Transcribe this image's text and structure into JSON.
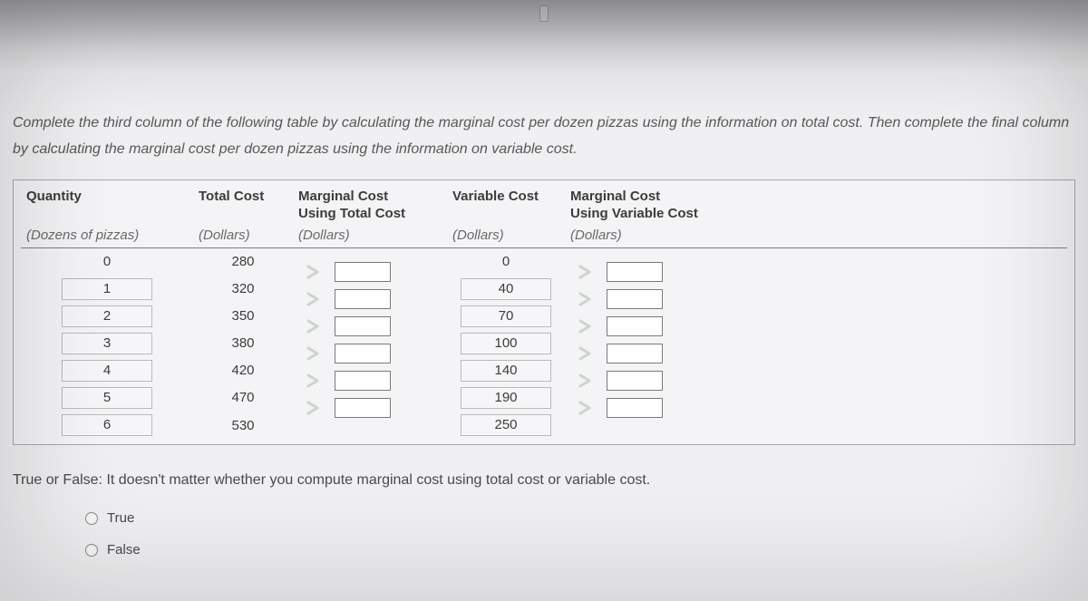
{
  "instructions": "Complete the third column of the following table by calculating the marginal cost per dozen pizzas using the information on total cost. Then complete the final column by calculating the marginal cost per dozen pizzas using the information on variable cost.",
  "headers": {
    "qty": "Quantity",
    "qty_sub": "(Dozens of pizzas)",
    "tc": "Total Cost",
    "tc_sub": "(Dollars)",
    "mc1": "Marginal Cost",
    "mc1b": "Using Total Cost",
    "mc1_sub": "(Dollars)",
    "vc": "Variable Cost",
    "vc_sub": "(Dollars)",
    "mc2": "Marginal Cost",
    "mc2b": "Using Variable Cost",
    "mc2_sub": "(Dollars)"
  },
  "rows": [
    {
      "qty": "0",
      "tc": "280",
      "vc": "0"
    },
    {
      "qty": "1",
      "tc": "320",
      "vc": "40"
    },
    {
      "qty": "2",
      "tc": "350",
      "vc": "70"
    },
    {
      "qty": "3",
      "tc": "380",
      "vc": "100"
    },
    {
      "qty": "4",
      "tc": "420",
      "vc": "140"
    },
    {
      "qty": "5",
      "tc": "470",
      "vc": "190"
    },
    {
      "qty": "6",
      "tc": "530",
      "vc": "250"
    }
  ],
  "question": "True or False: It doesn't matter whether you compute marginal cost using total cost or variable cost.",
  "opt_true": "True",
  "opt_false": "False"
}
